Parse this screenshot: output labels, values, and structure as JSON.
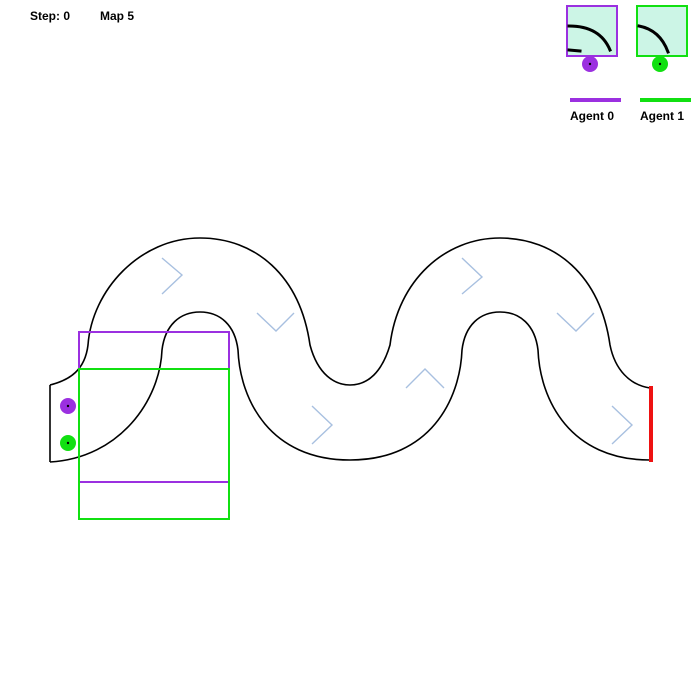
{
  "hud": {
    "step_text": "Step: 0",
    "map_text": "Map 5"
  },
  "goal": {
    "color": "#ee1111"
  },
  "track": {
    "wall_color": "#000000",
    "fill_color": "#ffffff",
    "chevron_color": "#a8c0e0"
  },
  "agents": [
    {
      "label": "Agent 0",
      "color": "#9b30e0",
      "view_bg": "#ccf5e6"
    },
    {
      "label": "Agent 1",
      "color": "#11e011",
      "view_bg": "#ccf5e6"
    }
  ]
}
